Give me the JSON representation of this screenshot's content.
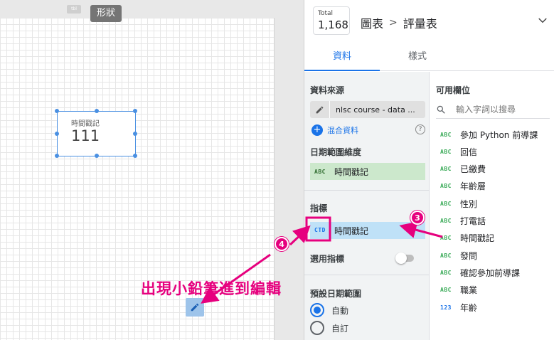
{
  "canvas": {
    "mini_chip": "tbl",
    "shape_tooltip": "形狀",
    "scorecard": {
      "label": "時間戳記",
      "value": "111"
    },
    "annotation": "出現小鉛筆進到編輯",
    "steps": [
      "4",
      "3"
    ]
  },
  "header": {
    "total_label": "Total",
    "total_value": "1,168",
    "breadcrumb": [
      "圖表",
      "評量表"
    ]
  },
  "tabs": [
    {
      "label": "資料",
      "active": true
    },
    {
      "label": "樣式",
      "active": false
    }
  ],
  "data_panel": {
    "datasource_title": "資料來源",
    "datasource_name": "nlsc course - data ...",
    "blend_label": "混合資料",
    "help": "?",
    "daterange_title": "日期範圍維度",
    "daterange_field": {
      "type": "ABC",
      "label": "時間戳記"
    },
    "metric_title": "指標",
    "metric_field": {
      "type": "CTD",
      "label": "時間戳記"
    },
    "optional_metric_label": "選用指標",
    "default_range_title": "預設日期範圍",
    "radio_options": [
      {
        "label": "自動",
        "selected": true
      },
      {
        "label": "自訂",
        "selected": false
      }
    ]
  },
  "available_fields": {
    "title": "可用欄位",
    "search_placeholder": "輸入字詞以搜尋",
    "items": [
      {
        "type": "ABC",
        "label": "參加 Python 前導課"
      },
      {
        "type": "ABC",
        "label": "回信"
      },
      {
        "type": "ABC",
        "label": "已繳費"
      },
      {
        "type": "ABC",
        "label": "年齡層"
      },
      {
        "type": "ABC",
        "label": "性別"
      },
      {
        "type": "ABC",
        "label": "打電話"
      },
      {
        "type": "ABC",
        "label": "時間戳記"
      },
      {
        "type": "ABC",
        "label": "發問"
      },
      {
        "type": "ABC",
        "label": "確認參加前導課"
      },
      {
        "type": "ABC",
        "label": "職業"
      },
      {
        "type": "123",
        "label": "年齡"
      }
    ]
  },
  "colors": {
    "accent": "#1a73e8",
    "annotation": "#e6007e",
    "dimension_chip": "#cce8cc",
    "metric_chip": "#bfe1f7"
  }
}
